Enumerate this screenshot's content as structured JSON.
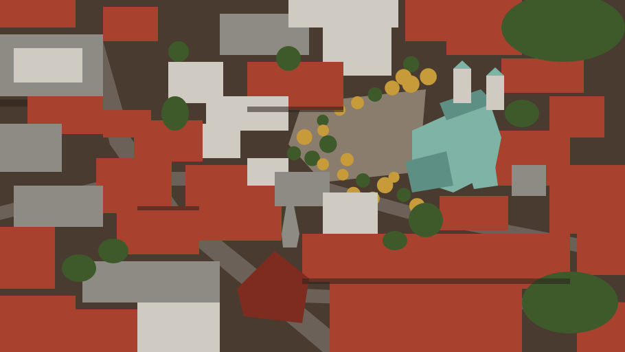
{
  "image": {
    "palette": {
      "ground": "#4a3b30",
      "street": "#6b6158",
      "roof_red": "#a8412e",
      "roof_red_dark": "#7e2c20",
      "roof_grey": "#8e8a84",
      "roof_light": "#cfcac2",
      "copper": "#7fb3a6",
      "copper_dark": "#5e8f84",
      "square": "#8a7d6d",
      "tree_yellow": "#c79a3a",
      "tree_green": "#3f5a2a",
      "tree_dark": "#2b3f1e",
      "shadow": "#2a221c"
    }
  }
}
